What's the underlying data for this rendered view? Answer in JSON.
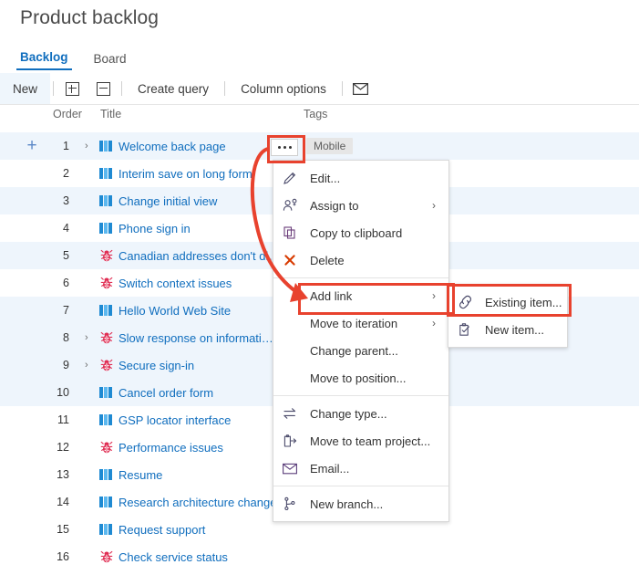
{
  "page": {
    "title": "Product backlog"
  },
  "pivot": {
    "tabs": [
      {
        "label": "Backlog",
        "selected": true
      },
      {
        "label": "Board",
        "selected": false
      }
    ]
  },
  "toolbar": {
    "new_label": "New",
    "expand_all_icon": "expand-all-icon",
    "collapse_all_icon": "collapse-all-icon",
    "create_query_label": "Create query",
    "column_options_label": "Column options",
    "email_icon": "envelope-icon"
  },
  "grid": {
    "columns": {
      "order": "Order",
      "title": "Title",
      "tags": "Tags"
    },
    "rows": [
      {
        "order": "1",
        "title": "Welcome back page",
        "type": "pbi",
        "expandable": true,
        "highlighted": true,
        "add_button": true,
        "tag": "Mobile"
      },
      {
        "order": "2",
        "title": "Interim save on long form",
        "type": "pbi",
        "expandable": false,
        "highlighted": false,
        "add_button": false,
        "tag": ""
      },
      {
        "order": "3",
        "title": "Change initial view",
        "type": "pbi",
        "expandable": false,
        "highlighted": true,
        "add_button": false,
        "tag": ""
      },
      {
        "order": "4",
        "title": "Phone sign in",
        "type": "pbi",
        "expandable": false,
        "highlighted": false,
        "add_button": false,
        "tag": ""
      },
      {
        "order": "5",
        "title": "Canadian addresses don't di…",
        "type": "bug",
        "expandable": false,
        "highlighted": true,
        "add_button": false,
        "tag": ""
      },
      {
        "order": "6",
        "title": "Switch context issues",
        "type": "bug",
        "expandable": false,
        "highlighted": false,
        "add_button": false,
        "tag": ""
      },
      {
        "order": "7",
        "title": "Hello World Web Site",
        "type": "pbi",
        "expandable": false,
        "highlighted": true,
        "add_button": false,
        "tag": ""
      },
      {
        "order": "8",
        "title": "Slow response on informati…",
        "type": "bug",
        "expandable": true,
        "highlighted": true,
        "add_button": false,
        "tag": ""
      },
      {
        "order": "9",
        "title": "Secure sign-in",
        "type": "bug",
        "expandable": true,
        "highlighted": true,
        "add_button": false,
        "tag": ""
      },
      {
        "order": "10",
        "title": "Cancel order form",
        "type": "pbi",
        "expandable": false,
        "highlighted": true,
        "add_button": false,
        "tag": ""
      },
      {
        "order": "11",
        "title": "GSP locator interface",
        "type": "pbi",
        "expandable": false,
        "highlighted": false,
        "add_button": false,
        "tag": ""
      },
      {
        "order": "12",
        "title": "Performance issues",
        "type": "bug",
        "expandable": false,
        "highlighted": false,
        "add_button": false,
        "tag": ""
      },
      {
        "order": "13",
        "title": "Resume",
        "type": "pbi",
        "expandable": false,
        "highlighted": false,
        "add_button": false,
        "tag": ""
      },
      {
        "order": "14",
        "title": "Research architecture changes",
        "type": "pbi",
        "expandable": false,
        "highlighted": false,
        "add_button": false,
        "tag": ""
      },
      {
        "order": "15",
        "title": "Request support",
        "type": "pbi",
        "expandable": false,
        "highlighted": false,
        "add_button": false,
        "tag": ""
      },
      {
        "order": "16",
        "title": "Check service status",
        "type": "bug",
        "expandable": false,
        "highlighted": false,
        "add_button": false,
        "tag": ""
      }
    ]
  },
  "context_menu": {
    "items": [
      {
        "label": "Edit...",
        "icon": "pencil-icon",
        "submenu": false,
        "separator_after": false
      },
      {
        "label": "Assign to",
        "icon": "person-assign-icon",
        "submenu": true,
        "separator_after": false
      },
      {
        "label": "Copy to clipboard",
        "icon": "copy-icon",
        "submenu": false,
        "separator_after": false
      },
      {
        "label": "Delete",
        "icon": "delete-x-icon",
        "submenu": false,
        "separator_after": true
      },
      {
        "label": "Add link",
        "icon": "",
        "submenu": true,
        "separator_after": false,
        "highlighted": true
      },
      {
        "label": "Move to iteration",
        "icon": "",
        "submenu": true,
        "separator_after": false
      },
      {
        "label": "Change parent...",
        "icon": "",
        "submenu": false,
        "separator_after": false
      },
      {
        "label": "Move to position...",
        "icon": "",
        "submenu": false,
        "separator_after": true
      },
      {
        "label": "Change type...",
        "icon": "change-type-icon",
        "submenu": false,
        "separator_after": false
      },
      {
        "label": "Move to team project...",
        "icon": "move-project-icon",
        "submenu": false,
        "separator_after": false
      },
      {
        "label": "Email...",
        "icon": "envelope-icon",
        "submenu": false,
        "separator_after": true
      },
      {
        "label": "New branch...",
        "icon": "branch-icon",
        "submenu": false,
        "separator_after": false
      }
    ]
  },
  "submenu": {
    "items": [
      {
        "label": "Existing item...",
        "icon": "link-icon",
        "highlighted": true
      },
      {
        "label": "New item...",
        "icon": "new-item-icon",
        "highlighted": false
      }
    ]
  },
  "annotations": {
    "accent_color": "#e8422e",
    "highlight_boxes": [
      "ellipsis-button",
      "add-link-menu-item",
      "existing-item-submenu-item"
    ],
    "arrow": "curved-arrow-from-ellipsis-to-add-link"
  },
  "colors": {
    "link_blue": "#106ebe",
    "row_highlight": "#eef5fc",
    "pbi_blue": "#1f8ad2",
    "bug_red": "#e02c52",
    "annotation_red": "#e8422e"
  }
}
